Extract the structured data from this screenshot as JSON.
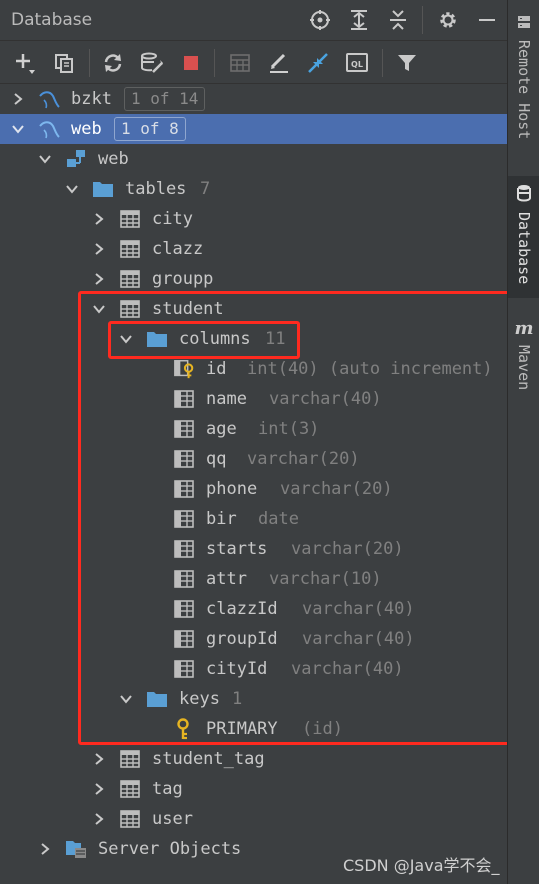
{
  "panel": {
    "title": "Database"
  },
  "header_icons": [
    "crosshair-icon",
    "expand-all-icon",
    "collapse-all-icon",
    "gear-icon",
    "minimize-icon"
  ],
  "toolbar_icons": [
    "add-icon",
    "copy-icon",
    "refresh-icon",
    "schema-sync-icon",
    "stop-icon",
    "table-grid-icon",
    "edit-icon",
    "jump-to-icon",
    "query-console-icon",
    "filter-icon"
  ],
  "colors": {
    "selection": "#4b6eaf",
    "highlight": "#ff2a1f",
    "folder": "#5a9fd4",
    "key": "#e6b422"
  },
  "tree": {
    "bzkt": {
      "label": "bzkt",
      "badge": "1 of 14"
    },
    "web": {
      "label": "web",
      "badge": "1 of 8"
    },
    "schema": {
      "label": "web"
    },
    "tables": {
      "label": "tables",
      "count": "7"
    },
    "table_city": "city",
    "table_clazz": "clazz",
    "table_groupp": "groupp",
    "table_student": "student",
    "columns": {
      "label": "columns",
      "count": "11"
    },
    "cols": [
      {
        "name": "id",
        "type": "int(40) (auto increment)"
      },
      {
        "name": "name",
        "type": "varchar(40)"
      },
      {
        "name": "age",
        "type": "int(3)"
      },
      {
        "name": "qq",
        "type": "varchar(20)"
      },
      {
        "name": "phone",
        "type": "varchar(20)"
      },
      {
        "name": "bir",
        "type": "date"
      },
      {
        "name": "starts",
        "type": "varchar(20)"
      },
      {
        "name": "attr",
        "type": "varchar(10)"
      },
      {
        "name": "clazzId",
        "type": "varchar(40)"
      },
      {
        "name": "groupId",
        "type": "varchar(40)"
      },
      {
        "name": "cityId",
        "type": "varchar(40)"
      }
    ],
    "keys": {
      "label": "keys",
      "count": "1"
    },
    "primary": {
      "name": "PRIMARY",
      "detail": "(id)"
    },
    "table_student_tag": "student_tag",
    "table_tag": "tag",
    "table_user": "user",
    "server_objects": "Server Objects"
  },
  "side_tabs": {
    "remote_host": "Remote Host",
    "database": "Database",
    "maven": "Maven"
  },
  "watermark": "CSDN @Java学不会_"
}
